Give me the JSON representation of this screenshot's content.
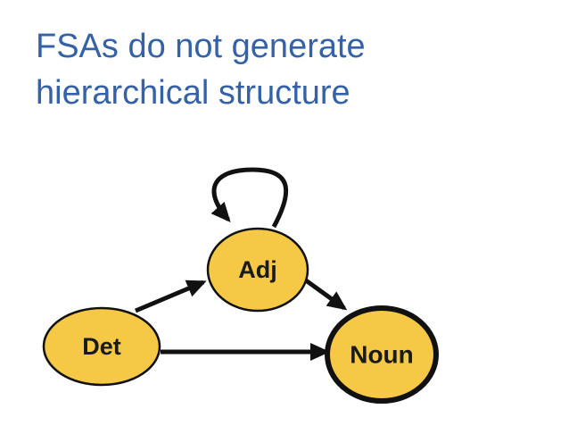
{
  "slide": {
    "title_line1": "FSAs do not generate",
    "title_line2": "hierarchical structure"
  },
  "diagram": {
    "nodes": [
      {
        "id": "det",
        "label": "Det",
        "final": false
      },
      {
        "id": "adj",
        "label": "Adj",
        "final": false
      },
      {
        "id": "noun",
        "label": "Noun",
        "final": true
      }
    ],
    "edges": [
      {
        "from": "det",
        "to": "adj"
      },
      {
        "from": "det",
        "to": "noun"
      },
      {
        "from": "adj",
        "to": "noun"
      },
      {
        "from": "adj",
        "to": "adj"
      }
    ],
    "colors": {
      "node_fill": "#f5c945",
      "stroke": "#111111",
      "title": "#3562a6"
    }
  }
}
